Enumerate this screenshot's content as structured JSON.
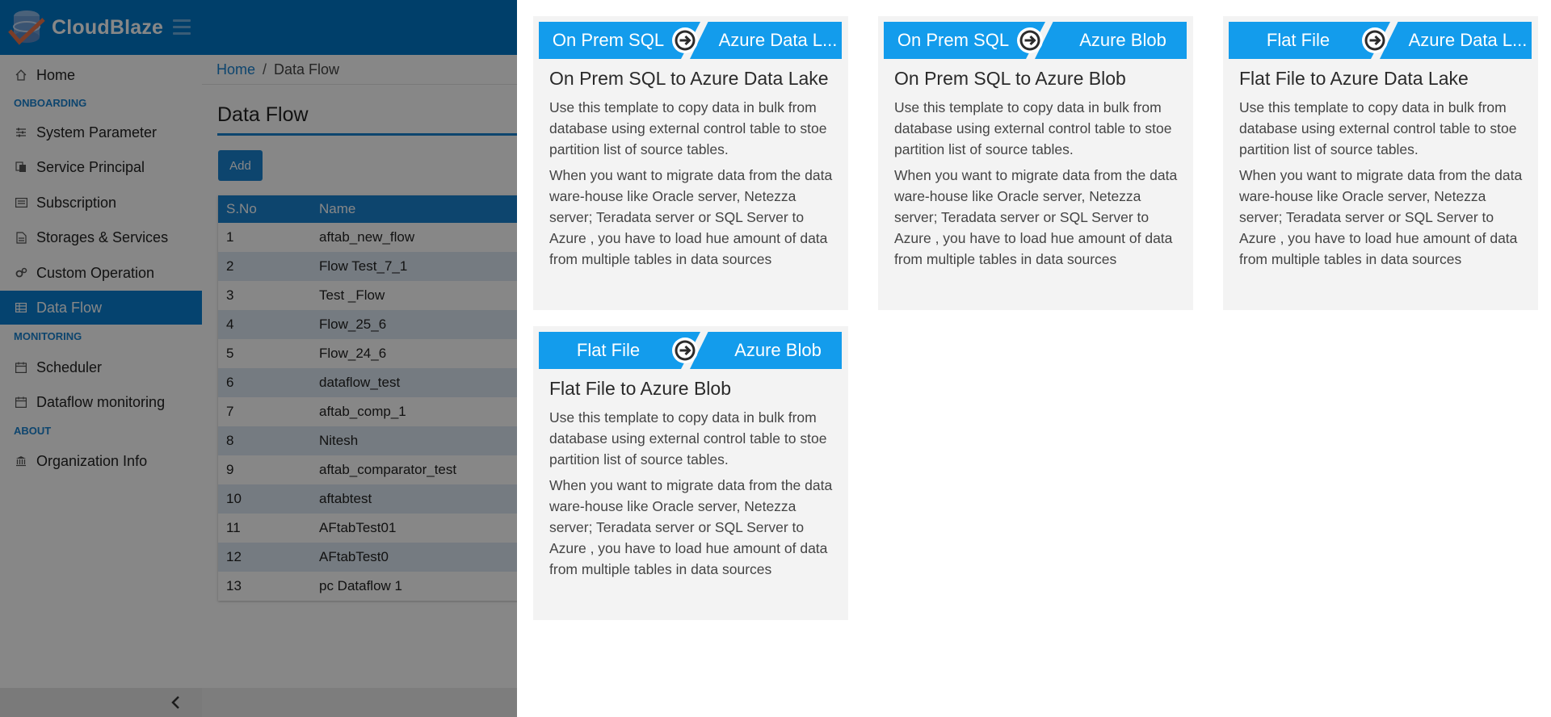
{
  "app": {
    "brand": "CloudBlaze"
  },
  "sidebar": {
    "sections": {
      "onboarding": "ONBOARDING",
      "monitoring": "MONITORING",
      "about": "ABOUT"
    },
    "items": [
      {
        "label": "Home",
        "icon": "home-icon"
      },
      {
        "label": "System Parameter",
        "icon": "sliders-icon"
      },
      {
        "label": "Service Principal",
        "icon": "documents-icon"
      },
      {
        "label": "Subscription",
        "icon": "card-icon"
      },
      {
        "label": "Storages & Services",
        "icon": "document-icon"
      },
      {
        "label": "Custom Operation",
        "icon": "cogs-icon"
      },
      {
        "label": "Data Flow",
        "icon": "table-icon"
      },
      {
        "label": "Scheduler",
        "icon": "calendar-icon"
      },
      {
        "label": "Dataflow monitoring",
        "icon": "calendar-icon"
      },
      {
        "label": "Organization Info",
        "icon": "bank-icon"
      }
    ]
  },
  "breadcrumb": {
    "home": "Home",
    "separator": "/",
    "current": "Data Flow"
  },
  "page": {
    "title": "Data Flow",
    "add_label": "Add"
  },
  "table": {
    "headers": [
      "S.No",
      "Name"
    ],
    "rows": [
      [
        "1",
        "aftab_new_flow"
      ],
      [
        "2",
        "Flow Test_7_1"
      ],
      [
        "3",
        "Test _Flow"
      ],
      [
        "4",
        "Flow_25_6"
      ],
      [
        "5",
        "Flow_24_6"
      ],
      [
        "6",
        "dataflow_test"
      ],
      [
        "7",
        "aftab_comp_1"
      ],
      [
        "8",
        "Nitesh"
      ],
      [
        "9",
        "aftab_comparator_test"
      ],
      [
        "10",
        "aftabtest"
      ],
      [
        "11",
        "AFtabTest01"
      ],
      [
        "12",
        "AFtabTest0"
      ],
      [
        "13",
        "pc Dataflow 1"
      ]
    ]
  },
  "templates": [
    {
      "source": "On Prem SQL",
      "target": "Azure Data L...",
      "title": "On Prem SQL to Azure Data Lake",
      "description": "Use this template to copy data in bulk from database using external control table to stoe partition list of source tables.",
      "detail": "When you want to migrate data from the data ware-house like Oracle server, Netezza server; Teradata server or SQL Server to Azure , you have to load hue amount of data from multiple tables in data sources"
    },
    {
      "source": "On Prem SQL",
      "target": "Azure Blob",
      "title": "On Prem SQL to Azure Blob",
      "description": "Use this template to copy data in bulk from database using external control table to stoe partition list of source tables.",
      "detail": "When you want to migrate data from the data ware-house like Oracle server, Netezza server; Teradata server or SQL Server to Azure , you have to load hue amount of data from multiple tables in data sources"
    },
    {
      "source": "Flat File",
      "target": "Azure Data L...",
      "title": "Flat File to Azure Data Lake",
      "description": "Use this template to copy data in bulk from database using external control table to stoe partition list of source tables.",
      "detail": "When you want to migrate data from the data ware-house like Oracle server, Netezza server; Teradata server or SQL Server to Azure , you have to load hue amount of data from multiple tables in data sources"
    },
    {
      "source": "Flat File",
      "target": "Azure Blob",
      "title": "Flat File to Azure Blob",
      "description": "Use this template to copy data in bulk from database using external control table to stoe partition list of source tables.",
      "detail": "When you want to migrate data from the data ware-house like Oracle server, Netezza server; Teradata server or SQL Server to Azure , you have to load hue amount of data from multiple tables in data sources"
    }
  ],
  "colors": {
    "primary": "#0078c8",
    "accent": "#139cec",
    "overlay": "#000000"
  }
}
